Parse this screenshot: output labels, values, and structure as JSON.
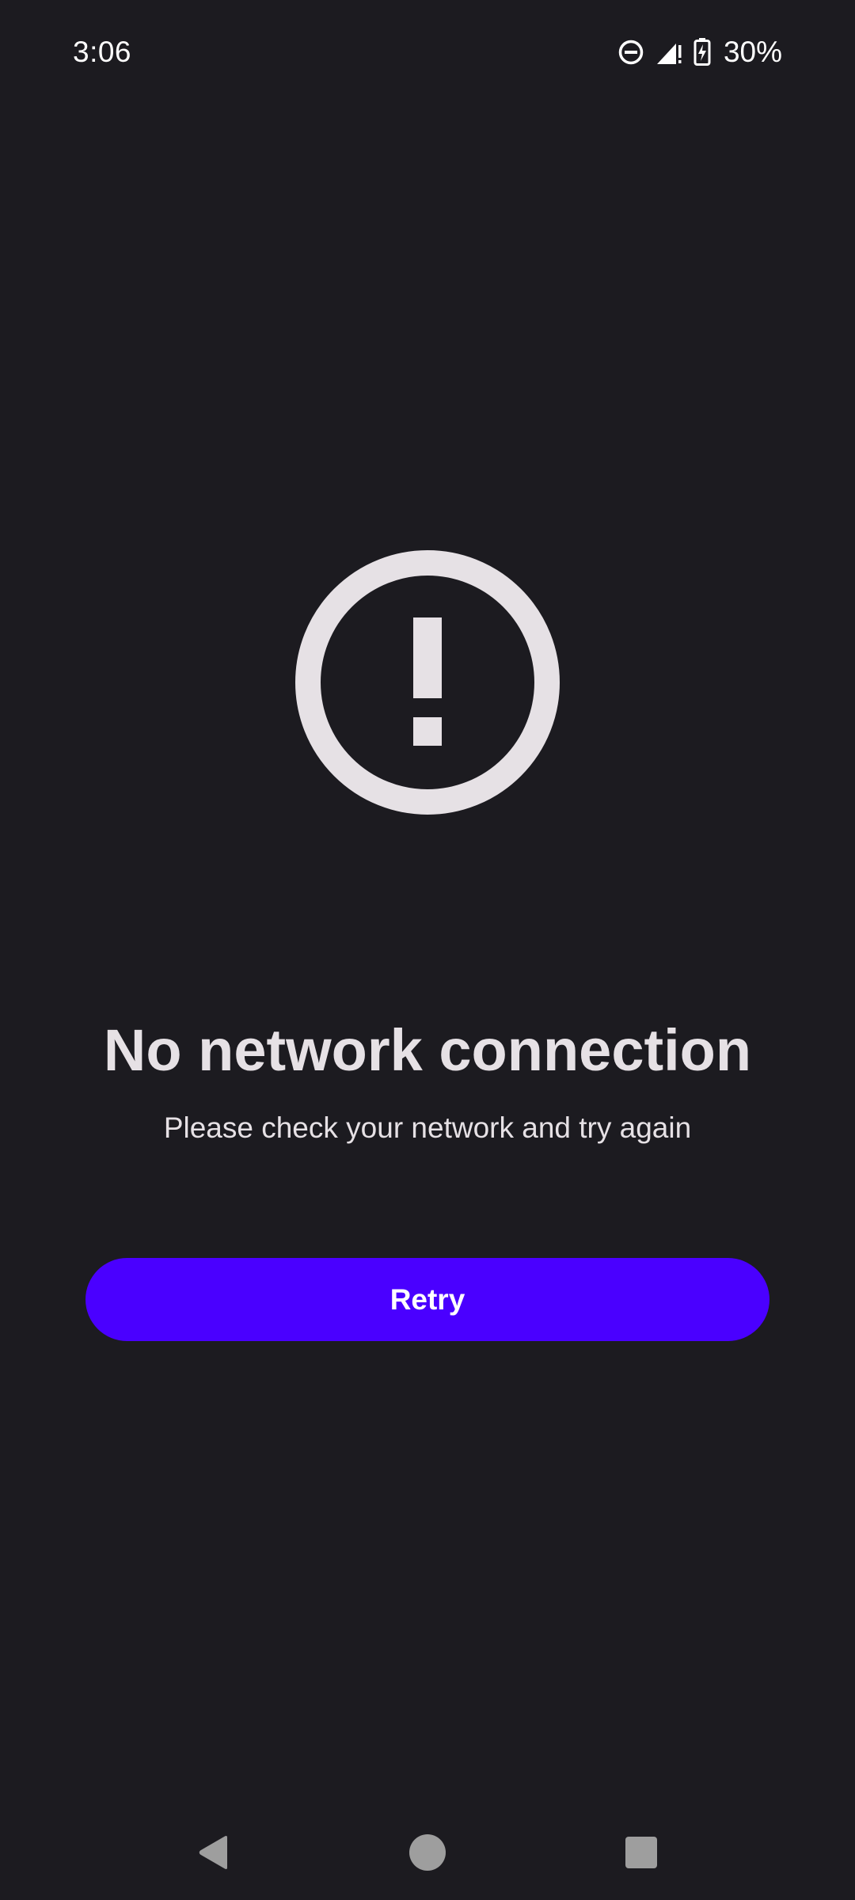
{
  "status_bar": {
    "time": "3:06",
    "battery_percent": "30%",
    "icons": [
      "do-not-disturb-icon",
      "signal-icon",
      "battery-charging-icon"
    ]
  },
  "error": {
    "icon": "alert-circle-icon",
    "title": "No network connection",
    "message": "Please check your network and try again"
  },
  "actions": {
    "retry_label": "Retry"
  },
  "colors": {
    "background": "#1c1b20",
    "text": "#e6e1e5",
    "accent": "#4a00ff"
  },
  "nav_bar": {
    "buttons": [
      "back-icon",
      "home-icon",
      "recents-icon"
    ]
  }
}
